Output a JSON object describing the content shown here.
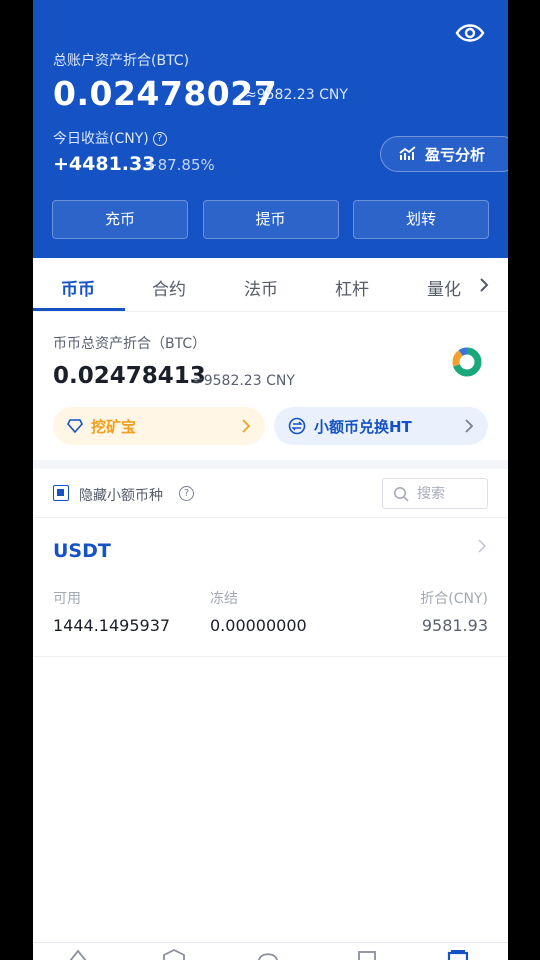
{
  "header": {
    "total_label": "总账户资产折合(BTC)",
    "total_btc": "0.02478027",
    "total_cny": "≈9582.23 CNY",
    "today_label": "今日收益(CNY)",
    "help_icon_text": "?",
    "today_pnl": "+4481.33",
    "today_pnl_pct": "+87.85%",
    "pnl_analysis_label": "盈亏分析",
    "actions": [
      "充币",
      "提币",
      "划转"
    ]
  },
  "tabs": [
    "币币",
    "合约",
    "法币",
    "杠杆",
    "量化"
  ],
  "summary": {
    "label": "币币总资产折合（BTC）",
    "value": "0.02478413",
    "approx": "≈9582.23 CNY",
    "mining_label": "挖矿宝",
    "convert_label": "小额币兑换HT"
  },
  "filter": {
    "hide_label": "隐藏小额币种",
    "help_icon_text": "?",
    "search_placeholder": "搜索"
  },
  "assets": [
    {
      "name": "USDT",
      "available_label": "可用",
      "available": "1444.1495937",
      "frozen_label": "冻结",
      "frozen": "0.00000000",
      "value_label": "折合(CNY)",
      "value": "9581.93"
    }
  ],
  "colors": {
    "brand_blue": "#1553c5",
    "mining_orange": "#f0a020",
    "donut_green": "#1aa77a",
    "donut_orange": "#f2a12a",
    "donut_blue": "#3b74d8"
  },
  "icons": [
    "eye-icon",
    "chart-trend-icon",
    "chevron-right-icon",
    "diamond-icon",
    "exchange-icon",
    "search-icon",
    "donut-chart-icon"
  ]
}
